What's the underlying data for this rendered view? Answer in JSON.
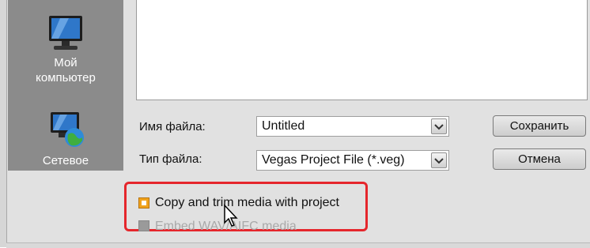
{
  "places": [
    {
      "label_line1": "Мой",
      "label_line2": "компьютер",
      "icon": "monitor-icon"
    },
    {
      "label": "Сетевое",
      "icon": "network-globe-icon"
    }
  ],
  "form": {
    "filename_label": "Имя файла:",
    "filename_value": "Untitled",
    "filetype_label": "Тип файла:",
    "filetype_value": "Vegas Project File (*.veg)"
  },
  "buttons": {
    "save": "Сохранить",
    "cancel": "Отмена"
  },
  "options": {
    "copy_trim": "Copy and trim media with project",
    "embed": "Embed WAV/AIFC media"
  },
  "colors": {
    "highlight": "#e5262c",
    "checkbox_checked": "#f0a21c",
    "places_bg": "#8b8b8b"
  }
}
